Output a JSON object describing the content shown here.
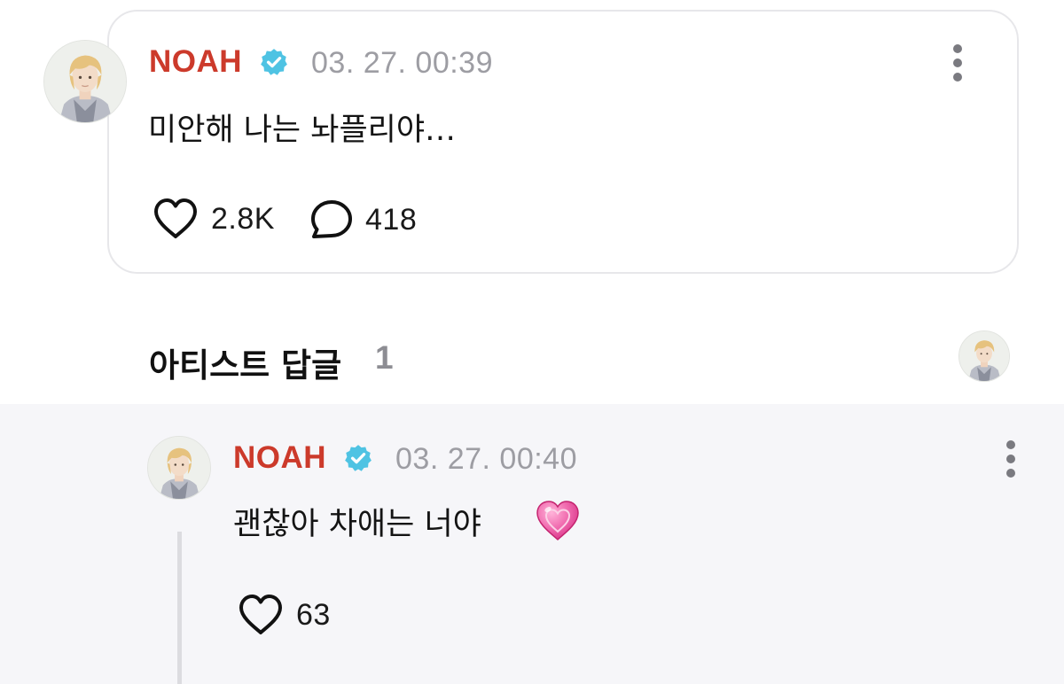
{
  "post": {
    "username": "NOAH",
    "timestamp": "03. 27. 00:39",
    "text": "미안해 나는 놔플리야…",
    "likes": "2.8K",
    "comments": "418",
    "verified_icon": "verified-badge-icon"
  },
  "artist_replies": {
    "title": "아티스트 답글",
    "count": "1"
  },
  "reply": {
    "username": "NOAH",
    "timestamp": "03. 27. 00:40",
    "text": "괜찮아 차애는 너야",
    "emoji": "💗",
    "likes": "63"
  },
  "colors": {
    "username": "#cc3a2b",
    "verified": "#4fc3e3",
    "timestamp": "#9d9da3",
    "reply_background": "#f6f6f9",
    "card_border": "#e7e7ea"
  }
}
